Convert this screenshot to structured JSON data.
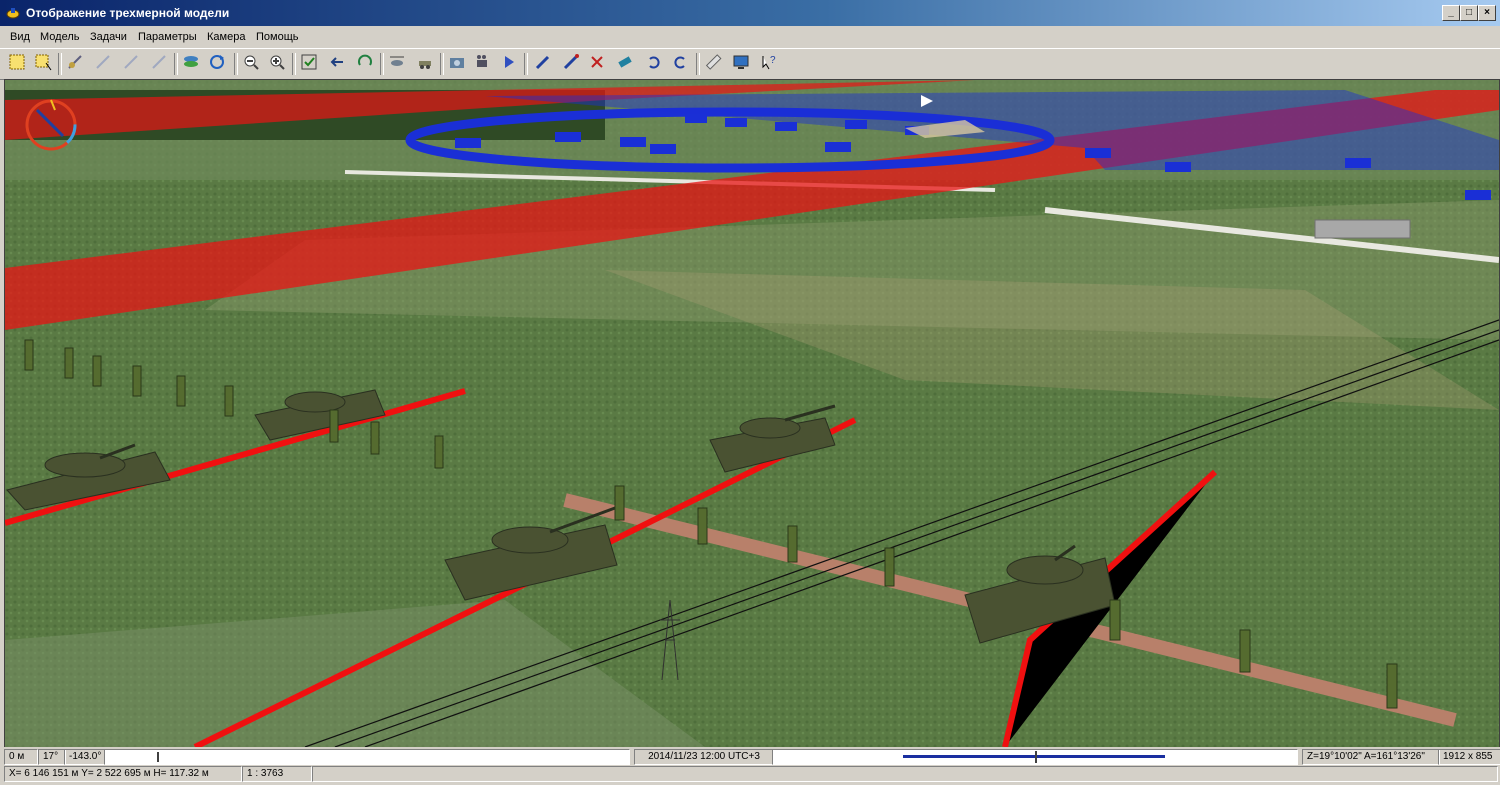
{
  "window": {
    "title": "Отображение трехмерной модели"
  },
  "menu": [
    "Вид",
    "Модель",
    "Задачи",
    "Параметры",
    "Камера",
    "Помощь"
  ],
  "toolbar_icons": [
    "select-rect-icon",
    "select-area-icon",
    "unit-icon",
    "unit-disabled-icon",
    "unit-disabled-icon-2",
    "unit-disabled-icon-3",
    "layers-icon",
    "refresh-icon",
    "zoom-out-icon",
    "zoom-in-icon",
    "fit-view-icon",
    "back-icon",
    "rotate-icon",
    "helicopter-icon",
    "vehicle-icon",
    "camera-icon",
    "video-icon",
    "play-icon",
    "draw-icon",
    "edit-icon",
    "delete-icon",
    "move-icon",
    "undo-icon",
    "redo-icon",
    "ruler-icon",
    "monitor-icon",
    "help-icon"
  ],
  "status": {
    "height": "0 м",
    "tilt": "17°",
    "heading": "-143.0°",
    "datetime": "2014/11/23  12:00  UTC+3",
    "angles": "Z=19°10'02\"  A=161°13'26\"",
    "resolution": "1912 x 855",
    "coords": "X= 6 146 151 м  Y= 2 522 695 м  H= 117.32 м",
    "scale": "1 : 3763"
  },
  "colors": {
    "red_zone": "#e81414",
    "blue_zone": "#1a2fd6",
    "terrain": "#5d7845",
    "tank": "#4a5232"
  }
}
